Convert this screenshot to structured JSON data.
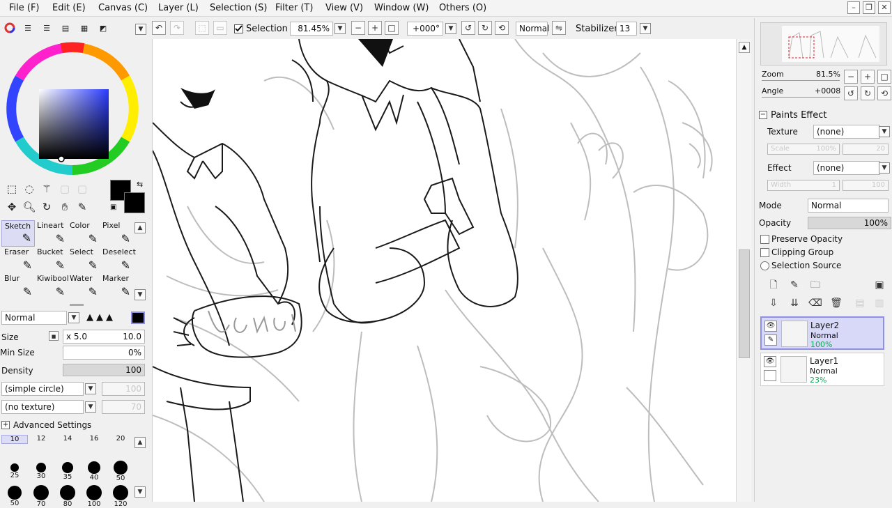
{
  "menu": [
    "File (F)",
    "Edit (E)",
    "Canvas (C)",
    "Layer (L)",
    "Selection (S)",
    "Filter (T)",
    "View (V)",
    "Window (W)",
    "Others (O)"
  ],
  "toolbar": {
    "selection_label": "Selection",
    "selection_checked": true,
    "zoom": "81.45%",
    "rotation": "+000°",
    "blend_mode": "Normal",
    "stabilizer_label": "Stabilizer",
    "stabilizer_value": "13"
  },
  "brushes": [
    {
      "label": "Sketch",
      "icon": "pencil-icon",
      "selected": true
    },
    {
      "label": "Lineart",
      "icon": "pen-icon",
      "selected": false
    },
    {
      "label": "Color",
      "icon": "brush-icon",
      "selected": false
    },
    {
      "label": "Pixel",
      "icon": "pixel-pen-icon",
      "selected": false
    },
    {
      "label": "Eraser",
      "icon": "eraser-icon",
      "selected": false
    },
    {
      "label": "Bucket",
      "icon": "bucket-icon",
      "selected": false
    },
    {
      "label": "Select",
      "icon": "select-brush-icon",
      "selected": false
    },
    {
      "label": "Deselect",
      "icon": "deselect-brush-icon",
      "selected": false
    },
    {
      "label": "Blur",
      "icon": "blur-icon",
      "selected": false
    },
    {
      "label": "Kiwibool",
      "icon": "marker-icon",
      "selected": false
    },
    {
      "label": "Water",
      "icon": "water-icon",
      "selected": false
    },
    {
      "label": "Marker",
      "icon": "marker-icon",
      "selected": false
    }
  ],
  "brush_settings": {
    "mode": "Normal",
    "size_label": "Size",
    "size_multiplier": "x 5.0",
    "size_value": "10.0",
    "min_size_label": "Min Size",
    "min_size_value": "0%",
    "density_label": "Density",
    "density_value": "100",
    "density_fraction": 1.0,
    "shape": "(simple circle)",
    "shape_value": "100",
    "texture": "(no texture)",
    "texture_value": "70",
    "advanced_label": "Advanced Settings"
  },
  "brush_sizes_row1": [
    "10",
    "12",
    "14",
    "16",
    "20"
  ],
  "brush_sizes_row2": [
    "25",
    "30",
    "35",
    "40",
    "50"
  ],
  "brush_sizes_row3": [
    "50",
    "70",
    "80",
    "100",
    "120"
  ],
  "navigator": {
    "zoom_label": "Zoom",
    "zoom_value": "81.5%",
    "angle_label": "Angle",
    "angle_value": "+0008"
  },
  "paints_effect": {
    "title": "Paints Effect",
    "texture_label": "Texture",
    "texture_value": "(none)",
    "scale_label": "Scale",
    "scale_value": "100%",
    "scale_right": "20",
    "effect_label": "Effect",
    "effect_value": "(none)",
    "width_label": "Width",
    "width_value": "1",
    "width_right": "100"
  },
  "layer_props": {
    "mode_label": "Mode",
    "mode_value": "Normal",
    "opacity_label": "Opacity",
    "opacity_value": "100%",
    "opacity_fraction": 1.0,
    "preserve_opacity": "Preserve Opacity",
    "clipping_group": "Clipping Group",
    "selection_source": "Selection Source"
  },
  "layers": [
    {
      "name": "Layer2",
      "mode": "Normal",
      "opacity": "100%",
      "selected": true
    },
    {
      "name": "Layer1",
      "mode": "Normal",
      "opacity": "23%",
      "selected": false
    }
  ],
  "colors": {
    "primary": "#000000",
    "secondary": "#000000",
    "hue": "#2b3cff",
    "selected_brush_bg": "#dcdcf5",
    "selected_layer_bg": "#d8d8f8"
  }
}
